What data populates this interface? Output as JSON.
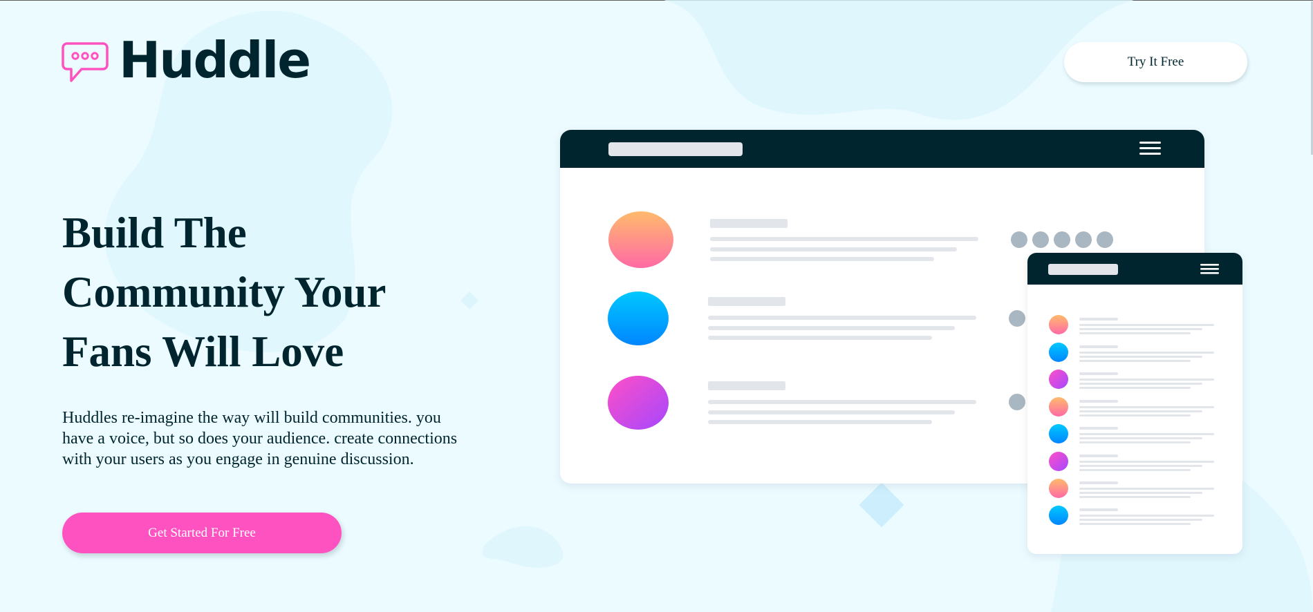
{
  "brand": {
    "name": "Huddle",
    "accent": "#ff52c1",
    "dark": "#00252e",
    "background": "#ebfbff"
  },
  "header": {
    "logo_icon": "speech-bubble-icon",
    "cta_label": "Try It Free"
  },
  "hero": {
    "title_lines": [
      "Build The",
      "Community Your",
      "Fans Will Love"
    ],
    "description_lines": [
      "Huddles re-imagine the way will build communities. you",
      "have a voice, but so does your audience. create connections",
      "with your users as you engage in genuine discussion."
    ],
    "cta_label": "Get Started For Free"
  },
  "illustration": {
    "menu_icon": "hamburger-menu-icon",
    "avatar_gradients": [
      [
        "#ffba6b",
        "#ff6aa6"
      ],
      [
        "#00c8ff",
        "#0086ff"
      ],
      [
        "#ff4fc6",
        "#a547ff"
      ]
    ]
  }
}
